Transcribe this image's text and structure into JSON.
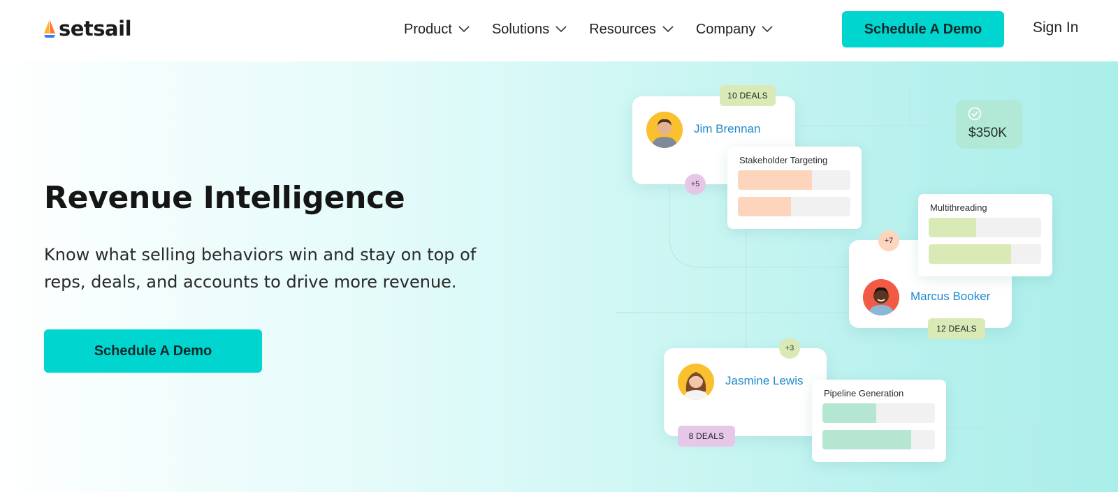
{
  "brand": {
    "name": "setsail"
  },
  "nav": {
    "items": [
      {
        "label": "Product"
      },
      {
        "label": "Solutions"
      },
      {
        "label": "Resources"
      },
      {
        "label": "Company"
      }
    ],
    "cta": "Schedule A Demo",
    "sign_in": "Sign In"
  },
  "hero": {
    "title": "Revenue Intelligence",
    "subtitle_line1": "Know what selling behaviors win and stay on top of",
    "subtitle_line2": "reps, deals, and accounts to drive more revenue.",
    "cta": "Schedule A Demo"
  },
  "colors": {
    "accent": "#00d6cf",
    "name_blue": "#1f8ac9",
    "peach": "#fdd5bc",
    "lime": "#d9eab7",
    "mint": "#b5e6d1",
    "lavender": "#e6c7e8"
  },
  "illustration": {
    "amount": "$350K",
    "jim": {
      "name": "Jim Brennan",
      "deals": "10 DEALS",
      "extra": "+5"
    },
    "marcus": {
      "name": "Marcus Booker",
      "deals": "12 DEALS",
      "extra": "+7"
    },
    "jasmine": {
      "name": "Jasmine Lewis",
      "deals": "8 DEALS",
      "extra": "+3"
    },
    "stakeholder": {
      "title": "Stakeholder Targeting",
      "fills": [
        0.66,
        0.47
      ]
    },
    "multithreading": {
      "title": "Multithreading",
      "fills": [
        0.42,
        0.73
      ]
    },
    "pipeline": {
      "title": "Pipeline Generation",
      "fills": [
        0.48,
        0.79
      ]
    }
  }
}
